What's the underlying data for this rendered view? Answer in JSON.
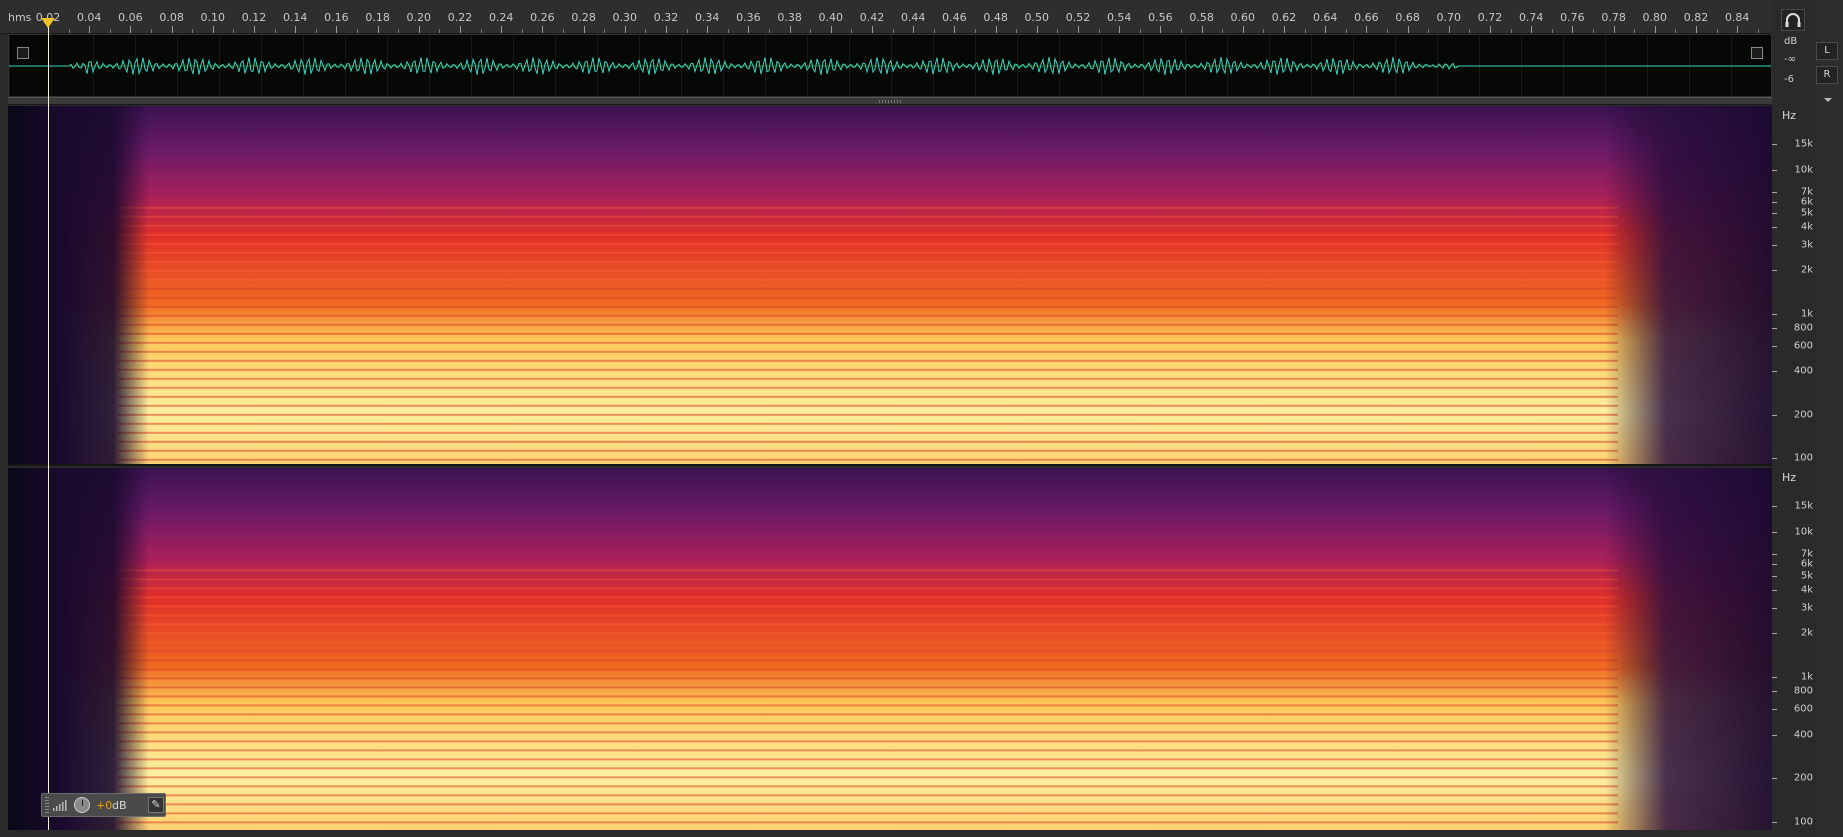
{
  "ruler": {
    "unit": "hms",
    "ticks": [
      "0.02",
      "0.04",
      "0.06",
      "0.08",
      "0.10",
      "0.12",
      "0.14",
      "0.16",
      "0.18",
      "0.20",
      "0.22",
      "0.24",
      "0.26",
      "0.28",
      "0.30",
      "0.32",
      "0.34",
      "0.36",
      "0.38",
      "0.40",
      "0.42",
      "0.44",
      "0.46",
      "0.48",
      "0.50",
      "0.52",
      "0.54",
      "0.56",
      "0.58",
      "0.60",
      "0.62",
      "0.64",
      "0.66",
      "0.68",
      "0.70",
      "0.72",
      "0.74",
      "0.76",
      "0.78",
      "0.80",
      "0.82",
      "0.84"
    ]
  },
  "amplitude_scale": {
    "unit": "dB",
    "labels": [
      "-∞",
      "-6"
    ]
  },
  "channels": {
    "left_label": "L",
    "right_label": "R"
  },
  "frequency_scale": {
    "unit": "Hz",
    "labels": [
      "15k",
      "10k",
      "7k",
      "6k",
      "5k",
      "4k",
      "3k",
      "2k",
      "1k",
      "800",
      "600",
      "400",
      "200",
      "100"
    ]
  },
  "hud": {
    "volume_value": "+0",
    "volume_unit": "dB",
    "pin_glyph": "✎"
  },
  "playhead": {
    "time": "0.02"
  },
  "colors": {
    "waveform": "#3fd3c0",
    "playhead_marker": "#f0c229",
    "hud_value": "#e3a21a",
    "spectrogram_low": "#1a0a2e",
    "spectrogram_mid": "#d8262a",
    "spectrogram_high": "#fff0a0"
  },
  "icons": {
    "monitor": "headphones-icon",
    "overview_zoom_in": "zoom-corner-icon",
    "hud_level": "level-meter-icon",
    "hud_knob": "volume-knob-icon"
  }
}
